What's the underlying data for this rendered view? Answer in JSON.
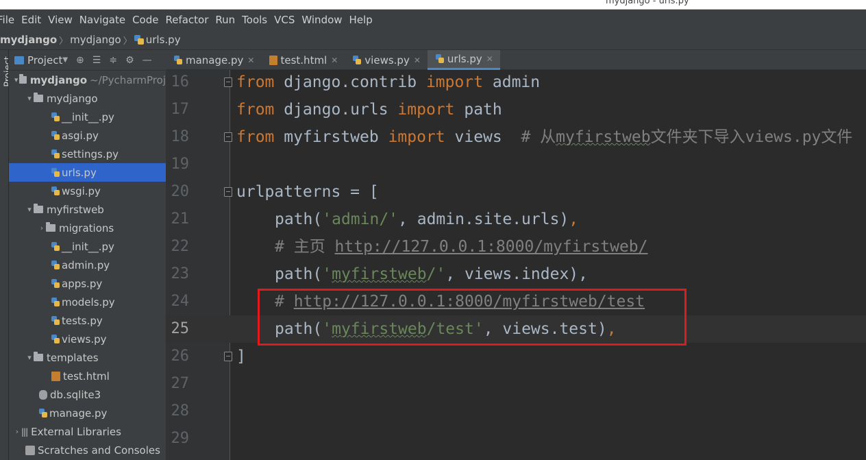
{
  "window": {
    "title": "mydjango - urls.py"
  },
  "menu": {
    "items": [
      "File",
      "Edit",
      "View",
      "Navigate",
      "Code",
      "Refactor",
      "Run",
      "Tools",
      "VCS",
      "Window",
      "Help"
    ]
  },
  "breadcrumb": {
    "items": [
      "mydjango",
      "mydjango",
      "urls.py"
    ]
  },
  "sidebar_strip": {
    "label": "Project"
  },
  "project_panel": {
    "title": "Project",
    "toolbar_icons": [
      "target-icon",
      "expand-all-icon",
      "collapse-all-icon",
      "gear-icon",
      "minimize-icon"
    ],
    "root_label": "mydjango",
    "root_path": "~/PycharmProj",
    "tree": [
      {
        "label": "mydjango",
        "type": "folder",
        "level": 1,
        "expanded": true
      },
      {
        "label": "__init__.py",
        "type": "py",
        "level": 2
      },
      {
        "label": "asgi.py",
        "type": "py",
        "level": 2
      },
      {
        "label": "settings.py",
        "type": "py",
        "level": 2
      },
      {
        "label": "urls.py",
        "type": "py",
        "level": 2,
        "selected": true
      },
      {
        "label": "wsgi.py",
        "type": "py",
        "level": 2
      },
      {
        "label": "myfirstweb",
        "type": "folder",
        "level": 1,
        "expanded": true
      },
      {
        "label": "migrations",
        "type": "folder",
        "level": 2,
        "expanded": false
      },
      {
        "label": "__init__.py",
        "type": "py",
        "level": 2
      },
      {
        "label": "admin.py",
        "type": "py",
        "level": 2
      },
      {
        "label": "apps.py",
        "type": "py",
        "level": 2
      },
      {
        "label": "models.py",
        "type": "py",
        "level": 2
      },
      {
        "label": "tests.py",
        "type": "py",
        "level": 2
      },
      {
        "label": "views.py",
        "type": "py",
        "level": 2
      },
      {
        "label": "templates",
        "type": "folder",
        "level": 1,
        "expanded": true
      },
      {
        "label": "test.html",
        "type": "html",
        "level": 2
      },
      {
        "label": "db.sqlite3",
        "type": "db",
        "level": 1
      },
      {
        "label": "manage.py",
        "type": "py",
        "level": 1
      }
    ],
    "external_libraries": "External Libraries",
    "scratches": "Scratches and Consoles"
  },
  "tabs": [
    {
      "label": "manage.py",
      "type": "py",
      "active": false
    },
    {
      "label": "test.html",
      "type": "html",
      "active": false
    },
    {
      "label": "views.py",
      "type": "py",
      "active": false
    },
    {
      "label": "urls.py",
      "type": "py",
      "active": true
    }
  ],
  "editor": {
    "lines": [
      {
        "n": "16"
      },
      {
        "n": "17"
      },
      {
        "n": "18"
      },
      {
        "n": "19"
      },
      {
        "n": "20"
      },
      {
        "n": "21"
      },
      {
        "n": "22"
      },
      {
        "n": "23"
      },
      {
        "n": "24"
      },
      {
        "n": "25"
      },
      {
        "n": "26"
      },
      {
        "n": "27"
      },
      {
        "n": "28"
      },
      {
        "n": "29"
      }
    ],
    "current_line": "25",
    "tokens": {
      "from": "from",
      "import": "import",
      "m1": " django.contrib ",
      "m1_name": " admin",
      "m2": " django.urls ",
      "m2_name": " path",
      "m3": " myfirstweb ",
      "m3_name": " views  ",
      "c18": "# 从",
      "c18_w": "myfirstweb",
      "c18_rest": "文件夹下导入views.py文件",
      "urlpatterns": "urlpatterns = [",
      "path": "path(",
      "s_admin": "'admin/'",
      "admin_rest": ", admin.site.urls)",
      "comma": ",",
      "c22": "# 主页 ",
      "c22_url": "http://127.0.0.1:8000/myfirstweb/",
      "s_q": "'",
      "s_myfirstweb_w": "myfirstweb",
      "s_slash": "/'",
      "index_rest": ", views.index),",
      "c24": "# ",
      "c24_url": "http://127.0.0.1:8000/myfirstweb/test",
      "s_test_w": "myfirstweb",
      "s_test_rest": "/test'",
      "test_rest": ", views.test)",
      "close": "]"
    }
  }
}
